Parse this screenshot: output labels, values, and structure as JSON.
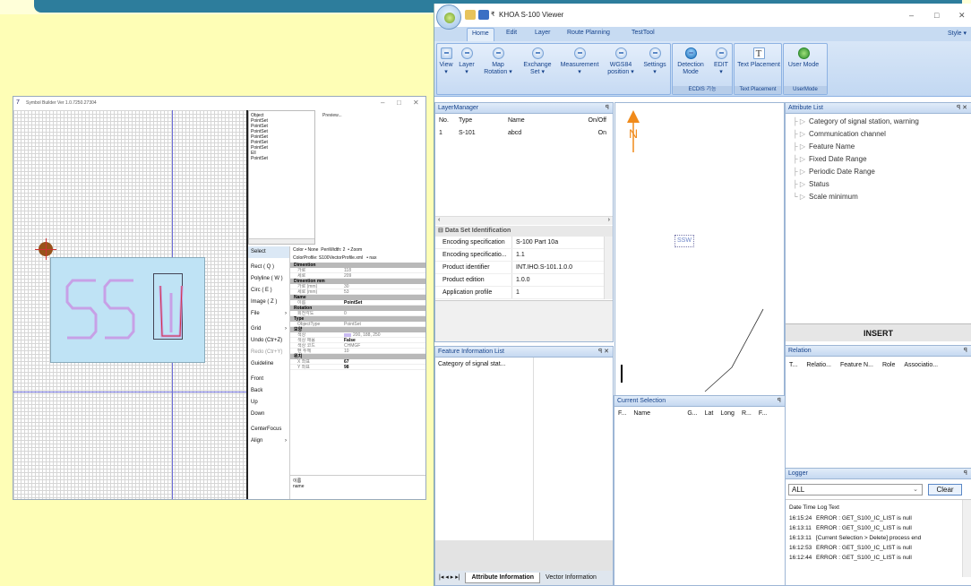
{
  "symbol_builder": {
    "title": "Symbol Builder Ver 1.0.7250.27304",
    "object_list": {
      "header": "Object",
      "items": [
        "PointSet",
        "PointSet",
        "PointSet",
        "PointSet",
        "PointSet",
        "PointSet",
        "Ell",
        "PointSet"
      ]
    },
    "preview_label": "Preview...",
    "tools": [
      "Select",
      "Rect ( Q )",
      "Polyline ( W )",
      "Circ ( E )",
      "Image ( Z )",
      "File",
      "Grid",
      "Undo (Ctr+Z)",
      "Redo (Ctr+Y)",
      "Guideline",
      "Front",
      "Back",
      "Up",
      "Down",
      "CenterFocus",
      "Align"
    ],
    "props_toolbar": {
      "color": "Color • None",
      "pen_width": "PenWidth: 2",
      "zoom": "• Zoom"
    },
    "color_profile": "ColorProfile: S100VectorProfile.xml",
    "color_profile_extra": "• nax",
    "properties": [
      {
        "category": "Dimention"
      },
      {
        "key": "가로",
        "value": "118"
      },
      {
        "key": "세로",
        "value": "209"
      },
      {
        "category": "Dimention mm"
      },
      {
        "key": "가로 (mm)",
        "value": "30"
      },
      {
        "key": "세로 (mm)",
        "value": "53"
      },
      {
        "category": "Name"
      },
      {
        "key": "이름",
        "value": "PointSet",
        "bold": true
      },
      {
        "category": "Rotation"
      },
      {
        "key": "회전각도",
        "value": "0"
      },
      {
        "category": "Type"
      },
      {
        "key": "ObjectType",
        "value": "PointSet"
      },
      {
        "category": "모양"
      },
      {
        "key": "색상",
        "value": "200, 188, 250",
        "swatch": true
      },
      {
        "key": "색상 채움",
        "value": "False",
        "bold": true
      },
      {
        "key": "색상 코드",
        "value": "CHMGF"
      },
      {
        "key": "펜 두께",
        "value": "10"
      },
      {
        "category": "위치"
      },
      {
        "key": "X 좌표",
        "value": "67",
        "bold": true
      },
      {
        "key": "Y 좌표",
        "value": "98",
        "bold": true
      }
    ],
    "description": {
      "title": "이름",
      "text": "name"
    },
    "colors": {
      "canvas_box": "#bfe3f5",
      "anchor": "#98521a",
      "stroke": "#c7a0e6",
      "guide": "#6d6dd8"
    }
  },
  "viewer": {
    "title": "KHOA S-100 Viewer",
    "tabs": [
      "Home",
      "Edit",
      "Layer",
      "Route Planning",
      "TestTool"
    ],
    "style_label": "Style ▾",
    "ribbon": [
      {
        "label": "View",
        "icon": "view-icon"
      },
      {
        "label": "Layer",
        "icon": "layer-icon"
      },
      {
        "label": "Map Rotation",
        "icon": "rotation-icon"
      },
      {
        "label": "Exchange Set",
        "icon": "exchange-icon"
      },
      {
        "label": "Measurement",
        "icon": "measure-icon"
      },
      {
        "label": "WGS84 position",
        "icon": "position-icon"
      },
      {
        "label": "Settings",
        "icon": "settings-icon"
      },
      {
        "label": "Detection Mode",
        "icon": "detection-icon"
      },
      {
        "label": "EDIT",
        "icon": "edit-icon"
      },
      {
        "label": "Text Placement",
        "icon": "text-icon"
      },
      {
        "label": "User Mode",
        "icon": "user-mode-icon"
      }
    ],
    "ribbon_groups": {
      "ecdis": "ECDIS 기능",
      "text": "Text Placement",
      "user": "UserMode"
    },
    "layer_manager": {
      "title": "LayerManager",
      "columns": [
        "No.",
        "Type",
        "Name",
        "On/Off"
      ],
      "rows": [
        {
          "no": "1",
          "type": "S-101",
          "name": "abcd",
          "on": "On"
        }
      ]
    },
    "dataset": {
      "title": "Data Set Identification",
      "rows": [
        {
          "k": "Encoding specification",
          "v": "S-100 Part 10a"
        },
        {
          "k": "Encoding specificatio...",
          "v": "1.1"
        },
        {
          "k": "Product identifier",
          "v": "INT.IHO.S-101.1.0.0"
        },
        {
          "k": "Product edition",
          "v": "1.0.0"
        },
        {
          "k": "Application profile",
          "v": "1"
        }
      ]
    },
    "feature_info": {
      "title": "Feature Information List",
      "item": "Category of signal stat..."
    },
    "bottom_tabs": {
      "active": "Attribute Information",
      "other": "Vector Information"
    },
    "map": {
      "symbol_text": "SSW",
      "north": "N"
    },
    "current_selection": {
      "title": "Current Selection",
      "columns": [
        "F...",
        "Name",
        "G...",
        "Lat",
        "Long",
        "R...",
        "F..."
      ]
    },
    "attribute_list": {
      "title": "Attribute List",
      "items": [
        "Category of signal station, warning",
        "Communication channel",
        "Feature Name",
        "Fixed Date Range",
        "Periodic Date Range",
        "Status",
        "Scale minimum"
      ],
      "insert": "INSERT"
    },
    "relation": {
      "title": "Relation",
      "columns": [
        "T...",
        "Relatio...",
        "Feature N...",
        "Role",
        "Associatio..."
      ]
    },
    "logger": {
      "title": "Logger",
      "filter": "ALL",
      "clear": "Clear",
      "header": "Date Time  Log Text",
      "entries": [
        {
          "t": "16:15:24",
          "m": "ERROR : GET_S100_IC_LIST is null"
        },
        {
          "t": "16:13:11",
          "m": "ERROR : GET_S100_IC_LIST is null"
        },
        {
          "t": "16:13:11",
          "m": "[Current Selection > Delete] process end"
        },
        {
          "t": "16:12:53",
          "m": "ERROR : GET_S100_IC_LIST is null"
        },
        {
          "t": "16:12:44",
          "m": "ERROR : GET_S100_IC_LIST is null"
        }
      ]
    }
  }
}
